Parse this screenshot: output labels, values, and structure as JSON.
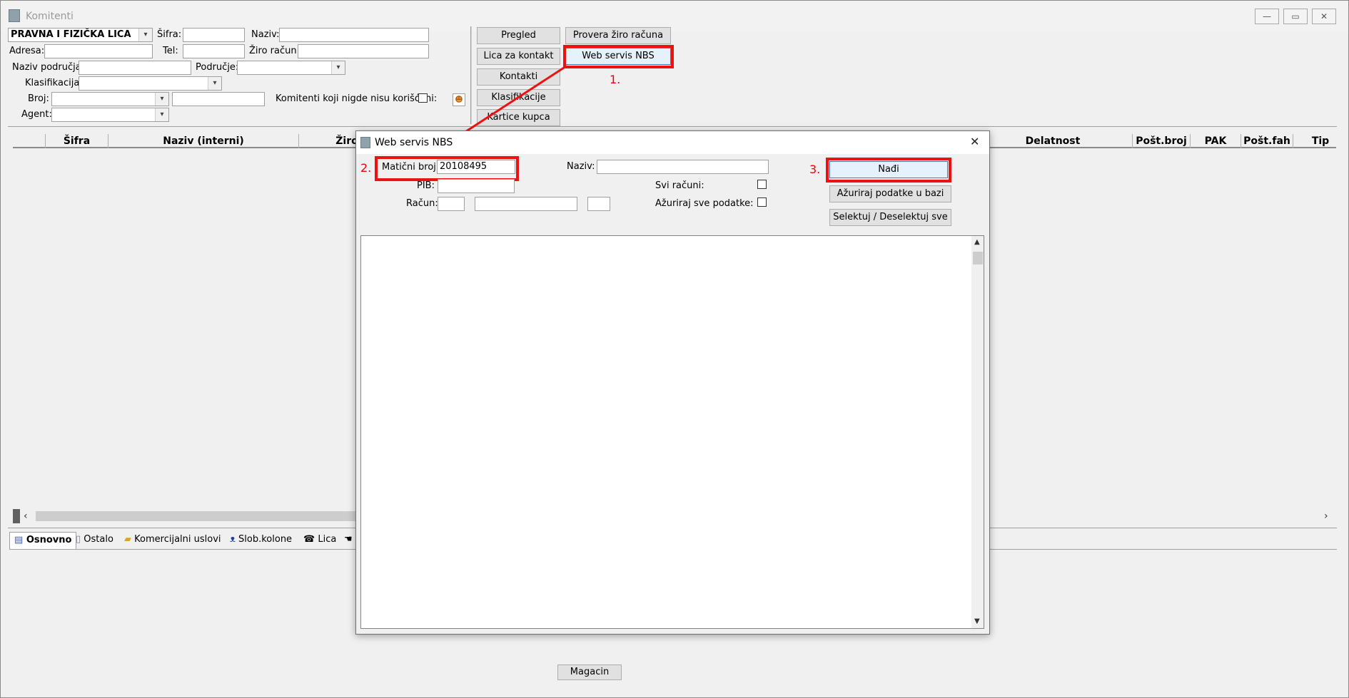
{
  "window": {
    "title": "Komitenti",
    "minimize": "—",
    "maximize": "▭",
    "close": "✕"
  },
  "filters": {
    "type_select": "PRAVNA I FIZIČKA LICA",
    "sifra_label": "Šifra:",
    "naziv_label": "Naziv:",
    "adresa_label": "Adresa:",
    "tel_label": "Tel:",
    "ziro_label": "Žiro račun:",
    "naziv_podrucja_label": "Naziv područja:",
    "podrucje_label": "Područje:",
    "klasifikacija_label": "Klasifikacija:",
    "broj_label": "Broj:",
    "agent_label": "Agent:",
    "unused_label": "Komitenti koji nigde nisu korišćeni:"
  },
  "side_buttons": {
    "pregled": "Pregled",
    "lica_za_kontakt": "Lica za kontakt",
    "kontakti": "Kontakti",
    "klasifikacije": "Klasifikacije",
    "kartice_kupca": "Kartice kupca",
    "provera_ziro": "Provera žiro računa",
    "web_servis": "Web servis NBS"
  },
  "grid": {
    "columns_left": [
      "Šifra",
      "Naziv (interni)",
      "Žiro"
    ],
    "columns_right": [
      "Delatnost",
      "Pošt.broj",
      "PAK",
      "Pošt.fah",
      "Tip"
    ]
  },
  "tabs": [
    "Osnovno",
    "Ostalo",
    "Komercijalni uslovi",
    "Slob.kolone",
    "Lica"
  ],
  "bottom": {
    "magacin": "Magacin"
  },
  "dialog": {
    "title": "Web servis NBS",
    "maticni_label": "Matični broj:",
    "maticni_value": "20108495",
    "naziv_label": "Naziv:",
    "pib_label": "PIB:",
    "racun_label": "Račun:",
    "svi_racuni_label": "Svi računi:",
    "azuriraj_sve_label": "Ažuriraj sve podatke:",
    "nadji": "Nađi",
    "azuriraj_bazu": "Ažuriraj podatke u bazi",
    "selektuj": "Selektuj / Deselektuj sve",
    "close": "✕"
  },
  "annotations": {
    "step1": "1.",
    "step2": "2.",
    "step3": "3.",
    "color": "#ee1111"
  }
}
